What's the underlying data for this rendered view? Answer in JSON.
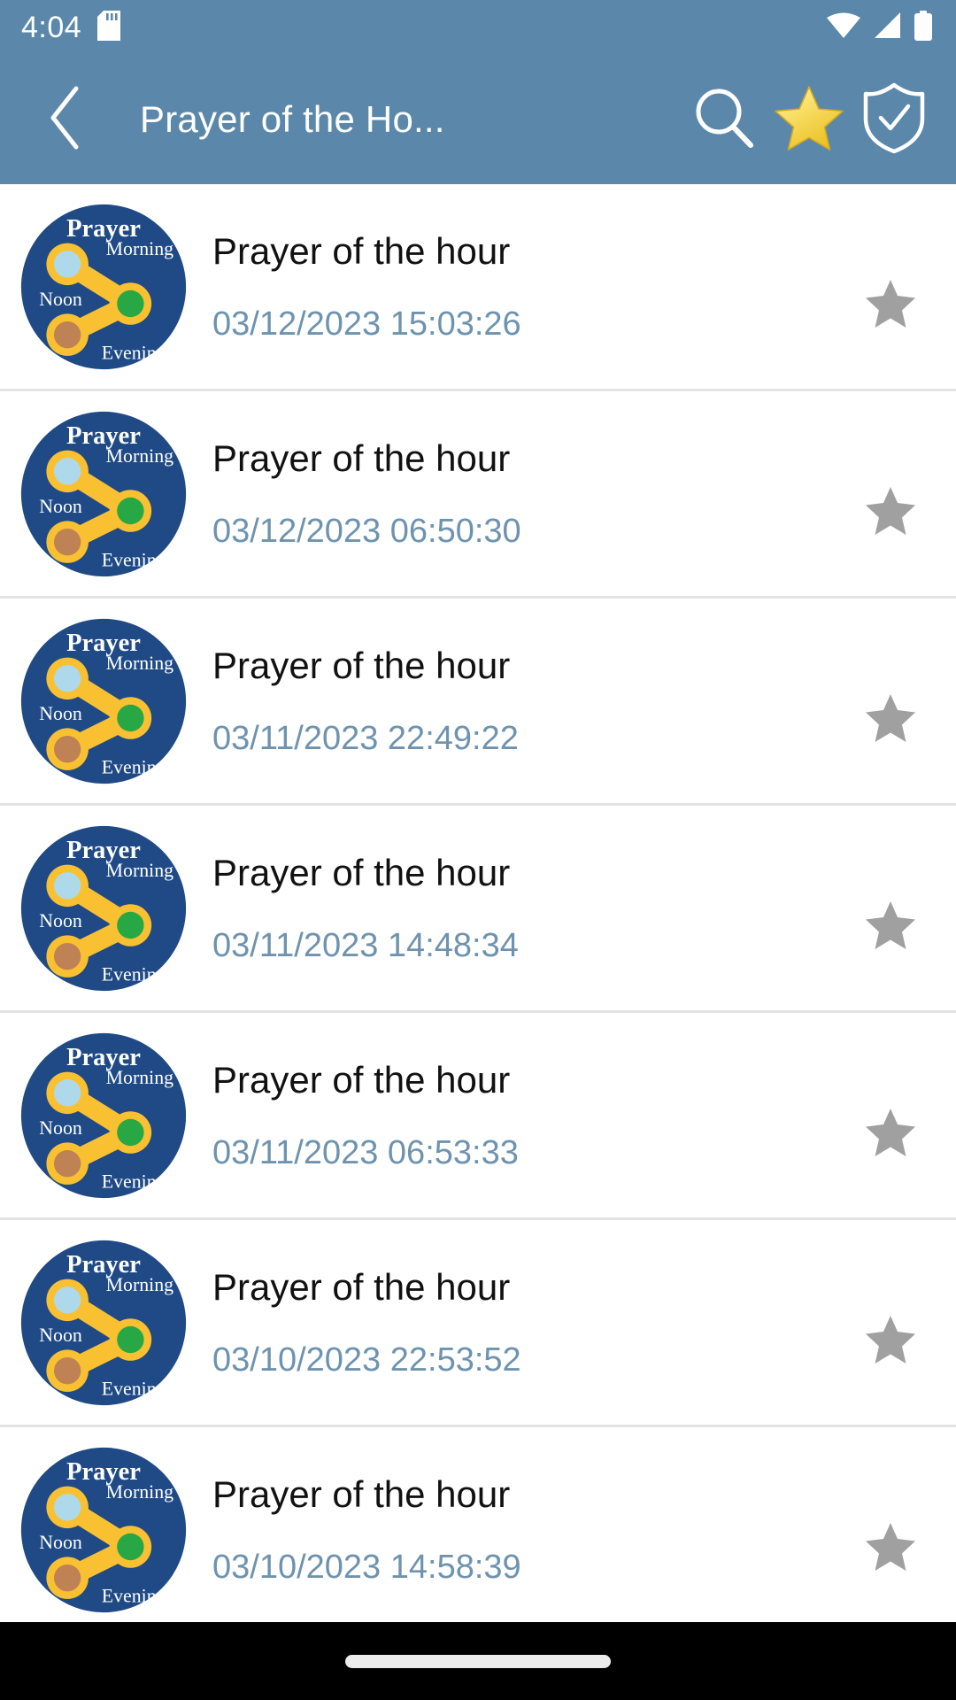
{
  "status_bar": {
    "time": "4:04",
    "icons": [
      "sd-card-icon",
      "wifi-icon",
      "cellular-signal-icon",
      "battery-icon"
    ]
  },
  "app_bar": {
    "back_icon": "chevron-left-icon",
    "title": "Prayer of the Ho...",
    "actions": [
      {
        "name": "search-icon",
        "label": "Search"
      },
      {
        "name": "star-icon",
        "label": "Favorites"
      },
      {
        "name": "shield-check-icon",
        "label": "Verified"
      }
    ]
  },
  "logo": {
    "brand": "Prayer",
    "nodes": [
      {
        "label": "Morning",
        "color": "#aed9ea"
      },
      {
        "label": "Noon",
        "color": "#27a844"
      },
      {
        "label": "Evening",
        "color": "#bf8254"
      }
    ],
    "circle_color": "#1f4a86",
    "link_color": "#f9c132"
  },
  "colors": {
    "header_blue": "#5b88aa",
    "date_text": "#6e93af",
    "title_text": "#111111",
    "star_inactive": "#a0a0a0",
    "star_active": "#f2cb2e",
    "divider": "#e3e3e3"
  },
  "list": {
    "items": [
      {
        "title": "Prayer of the hour",
        "date": "03/12/2023 15:03:26",
        "starred": false
      },
      {
        "title": "Prayer of the hour",
        "date": "03/12/2023 06:50:30",
        "starred": false
      },
      {
        "title": "Prayer of the hour",
        "date": "03/11/2023 22:49:22",
        "starred": false
      },
      {
        "title": "Prayer of the hour",
        "date": "03/11/2023 14:48:34",
        "starred": false
      },
      {
        "title": "Prayer of the hour",
        "date": "03/11/2023 06:53:33",
        "starred": false
      },
      {
        "title": "Prayer of the hour",
        "date": "03/10/2023 22:53:52",
        "starred": false
      },
      {
        "title": "Prayer of the hour",
        "date": "03/10/2023 14:58:39",
        "starred": false
      }
    ]
  },
  "nav_bar": {
    "handle": "gesture-pill"
  }
}
